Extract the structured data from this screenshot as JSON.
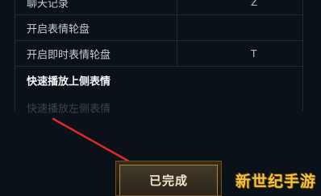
{
  "rows": [
    {
      "action": "聊天记录",
      "key": "Z"
    },
    {
      "action": "开启表情轮盘",
      "key": ""
    },
    {
      "action": "开启即时表情轮盘",
      "key": "T"
    },
    {
      "action": "快速播放上侧表情",
      "key": ""
    },
    {
      "action": "快速播放左侧表情",
      "key": ""
    }
  ],
  "done_button": {
    "label": "已完成"
  },
  "watermark": {
    "text": "新世纪手游"
  },
  "colors": {
    "background": "#0b1118",
    "arrow": "#e02a2a",
    "button_text": "#f3e7cc",
    "watermark": "#f0c24a"
  }
}
